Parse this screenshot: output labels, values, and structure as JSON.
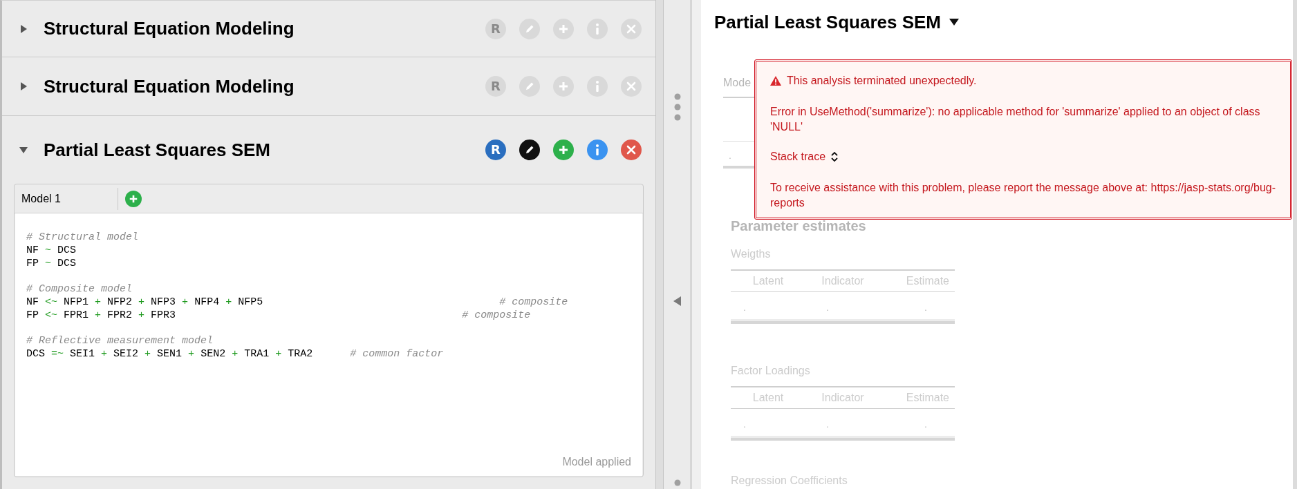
{
  "analyses": [
    {
      "title": "Structural Equation Modeling",
      "expanded": false,
      "icons_enabled": false,
      "icons": [
        {
          "kind": "r",
          "label": "R"
        },
        {
          "kind": "edit"
        },
        {
          "kind": "add"
        },
        {
          "kind": "info"
        },
        {
          "kind": "close"
        }
      ]
    },
    {
      "title": "Structural Equation Modeling",
      "expanded": false,
      "icons_enabled": false,
      "icons": [
        {
          "kind": "r",
          "label": "R"
        },
        {
          "kind": "edit"
        },
        {
          "kind": "add"
        },
        {
          "kind": "info"
        },
        {
          "kind": "close"
        }
      ]
    },
    {
      "title": "Partial Least Squares SEM",
      "expanded": true,
      "icons_enabled": true,
      "icons": [
        {
          "kind": "r",
          "label": "R"
        },
        {
          "kind": "edit"
        },
        {
          "kind": "add"
        },
        {
          "kind": "info"
        },
        {
          "kind": "close"
        }
      ]
    }
  ],
  "model_editor": {
    "tabs": [
      {
        "label": "Model 1",
        "selected": true
      }
    ],
    "blocks": [
      [
        [
          {
            "kind": "comment",
            "text": "# Structural model"
          }
        ],
        [
          {
            "kind": "name",
            "text": "NF "
          },
          {
            "kind": "op",
            "text": "~"
          },
          {
            "kind": "name",
            "text": " DCS"
          }
        ],
        [
          {
            "kind": "name",
            "text": "FP "
          },
          {
            "kind": "op",
            "text": "~"
          },
          {
            "kind": "name",
            "text": " DCS"
          }
        ]
      ],
      [
        [
          {
            "kind": "comment",
            "text": "# Composite model"
          }
        ],
        [
          {
            "kind": "name",
            "text": "NF "
          },
          {
            "kind": "op",
            "text": "<~"
          },
          {
            "kind": "name",
            "text": " NFP1 "
          },
          {
            "kind": "op",
            "text": "+"
          },
          {
            "kind": "name",
            "text": " NFP2 "
          },
          {
            "kind": "op",
            "text": "+"
          },
          {
            "kind": "name",
            "text": " NFP3 "
          },
          {
            "kind": "op",
            "text": "+"
          },
          {
            "kind": "name",
            "text": " NFP4 "
          },
          {
            "kind": "op",
            "text": "+"
          },
          {
            "kind": "name",
            "text": " NFP5                                      "
          },
          {
            "kind": "comment",
            "text": "# composite"
          }
        ],
        [
          {
            "kind": "name",
            "text": "FP "
          },
          {
            "kind": "op",
            "text": "<~"
          },
          {
            "kind": "name",
            "text": " FPR1 "
          },
          {
            "kind": "op",
            "text": "+"
          },
          {
            "kind": "name",
            "text": " FPR2 "
          },
          {
            "kind": "op",
            "text": "+"
          },
          {
            "kind": "name",
            "text": " FPR3                                              "
          },
          {
            "kind": "comment",
            "text": "# composite"
          }
        ]
      ],
      [
        [
          {
            "kind": "comment",
            "text": "# Reflective measurement model"
          }
        ],
        [
          {
            "kind": "name",
            "text": "DCS "
          },
          {
            "kind": "op",
            "text": "=~"
          },
          {
            "kind": "name",
            "text": " SEI1 "
          },
          {
            "kind": "op",
            "text": "+"
          },
          {
            "kind": "name",
            "text": " SEI2 "
          },
          {
            "kind": "op",
            "text": "+"
          },
          {
            "kind": "name",
            "text": " SEN1 "
          },
          {
            "kind": "op",
            "text": "+"
          },
          {
            "kind": "name",
            "text": " SEN2 "
          },
          {
            "kind": "op",
            "text": "+"
          },
          {
            "kind": "name",
            "text": " TRA1 "
          },
          {
            "kind": "op",
            "text": "+"
          },
          {
            "kind": "name",
            "text": " TRA2      "
          },
          {
            "kind": "comment",
            "text": "# common factor"
          }
        ]
      ]
    ],
    "status": "Model applied"
  },
  "results": {
    "title": "Partial Least Squares SEM",
    "model_table_title": "Mode",
    "model_table_cell": ".",
    "error": {
      "headline": "This analysis terminated unexpectedly.",
      "message": "Error in UseMethod('summarize'): no applicable method for 'summarize' applied to an object of class 'NULL'",
      "stack_trace": "Stack trace",
      "help": "To receive assistance with this problem, please report the message above at: https://jasp-stats.org/bug-reports"
    },
    "section_title": "Parameter estimates",
    "tables": [
      {
        "title": "Weigths",
        "columns": [
          "Latent",
          "Indicator",
          "Estimate"
        ],
        "rows": [
          [
            ".",
            ".",
            "."
          ]
        ]
      },
      {
        "title": "Factor Loadings",
        "columns": [
          "Latent",
          "Indicator",
          "Estimate"
        ],
        "rows": [
          [
            ".",
            ".",
            "."
          ]
        ]
      }
    ],
    "next_table_title": "Regression Coefficients"
  }
}
